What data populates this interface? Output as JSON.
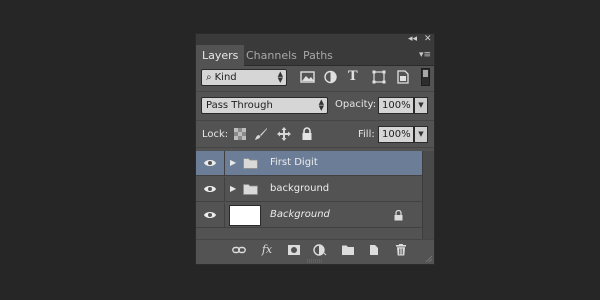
{
  "panel": {
    "collapse_label": "◂◂",
    "close_label": "✕",
    "menu_label": "▾≡"
  },
  "tabs": [
    {
      "label": "Layers",
      "active": true
    },
    {
      "label": "Channels",
      "active": false
    },
    {
      "label": "Paths",
      "active": false
    }
  ],
  "filter": {
    "kind_label": "Kind",
    "search_glyph": "⌕",
    "icons": [
      "image-filter-icon",
      "adjustment-filter-icon",
      "type-filter-icon",
      "shape-filter-icon",
      "smart-object-filter-icon"
    ],
    "type_glyph": "T"
  },
  "blend": {
    "mode": "Pass Through",
    "opacity_label": "Opacity:",
    "opacity_value": "100%"
  },
  "lock": {
    "label": "Lock:",
    "fill_label": "Fill:",
    "fill_value": "100%"
  },
  "layers": [
    {
      "name": "First Digit",
      "type": "group",
      "selected": true,
      "visible": true
    },
    {
      "name": "background",
      "type": "group",
      "selected": false,
      "visible": true
    },
    {
      "name": "Background",
      "type": "background",
      "selected": false,
      "visible": true,
      "locked": true
    }
  ],
  "bottom": {
    "fx_label": "fx"
  },
  "colors": {
    "panel_bg": "#535353",
    "selected_row": "#6b7d97",
    "page_bg": "#262627"
  }
}
